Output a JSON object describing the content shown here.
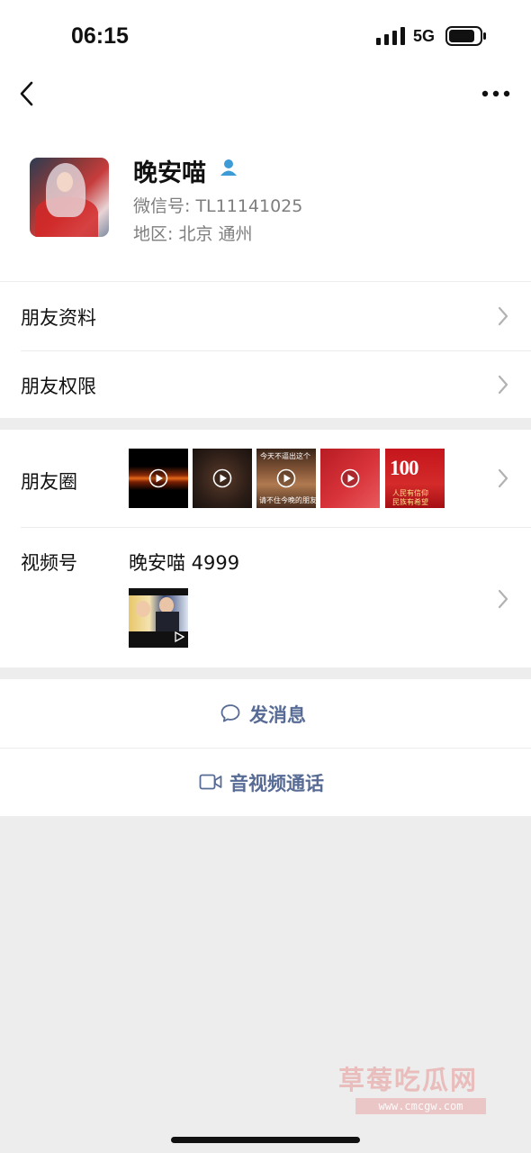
{
  "status_bar": {
    "time": "06:15",
    "network": "5G"
  },
  "profile": {
    "name": "晚安喵",
    "wechat_id": "微信号: TL11141025",
    "region": "地区: 北京 通州"
  },
  "menu": {
    "friend_info": "朋友资料",
    "friend_permissions": "朋友权限"
  },
  "moments": {
    "label": "朋友圈",
    "thumb3_top_text": "今天不逼出这个",
    "thumb3_bottom_text": "请不住今晚的朋友圈",
    "thumb5_big_text": "100",
    "thumb5_line1": "人民有信仰",
    "thumb5_line2": "民族有希望"
  },
  "channels": {
    "label": "视频号",
    "account_name": "晚安喵 4999"
  },
  "actions": {
    "send_message": "发消息",
    "video_call": "音视频通话"
  },
  "watermark": {
    "text": "草莓吃瓜网",
    "url": "www.cmcgw.com"
  },
  "colors": {
    "link": "#576b95",
    "verify": "#3d9bd5",
    "background": "#ededed"
  },
  "icons": {
    "back": "chevron-left-icon",
    "more": "more-dots-icon",
    "verify": "person-verified-icon",
    "chevron": "chevron-right-icon",
    "message": "chat-bubble-icon",
    "video": "video-camera-icon",
    "play": "play-icon"
  }
}
